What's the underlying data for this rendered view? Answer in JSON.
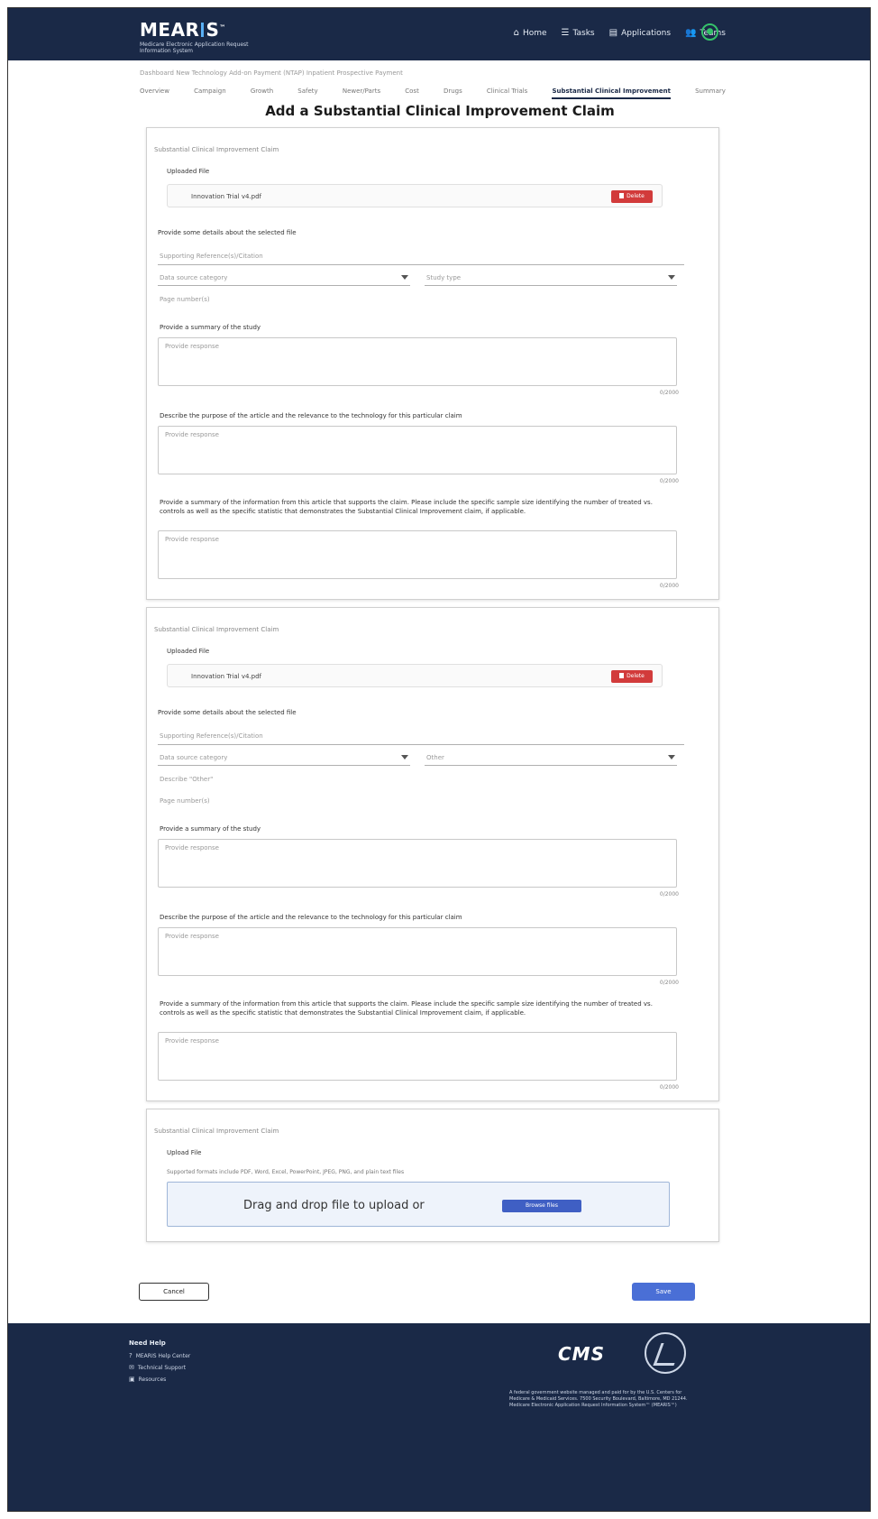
{
  "header": {
    "logo_main": "MEAR",
    "logo_main_end": "S",
    "logo_tm": "™",
    "logo_sub": "Medicare Electronic Application Request Information System",
    "nav": [
      {
        "label": "Home",
        "icon": "home-icon"
      },
      {
        "label": "Tasks",
        "icon": "tasks-icon"
      },
      {
        "label": "Applications",
        "icon": "applications-icon"
      },
      {
        "label": "Teams",
        "icon": "teams-icon"
      }
    ]
  },
  "breadcrumb": "Dashboard  New Technology Add-on Payment (NTAP) Inpatient Prospective Payment",
  "tabs": [
    "Overview",
    "Campaign",
    "Growth",
    "Safety",
    "Newer/Parts",
    "Cost",
    "Drugs",
    "Clinical Trials",
    "Substantial Clinical Improvement",
    "Summary"
  ],
  "active_tab_index": 8,
  "page_title": "Add a Substantial Clinical Improvement Claim",
  "card1": {
    "title": "Substantial Clinical Improvement Claim",
    "uploaded_label": "Uploaded File",
    "file_name": "Innovation Trial v4.pdf",
    "delete_label": "Delete",
    "details_prompt": "Provide some details about the selected file",
    "supporting_placeholder": "Supporting Reference(s)/Citation",
    "data_source_placeholder": "Data source category",
    "study_type_placeholder": "Study type",
    "page_numbers_placeholder": "Page number(s)",
    "q1": "Provide a summary of the study",
    "q1_placeholder": "Provide response",
    "q1_counter": "0/2000",
    "q2": "Describe the purpose of the article and the relevance to the technology for this particular claim",
    "q2_placeholder": "Provide response",
    "q2_counter": "0/2000",
    "q3": "Provide a summary of the information from this article that supports the claim. Please include the specific sample size identifying the number of treated vs. controls as well as the specific statistic that demonstrates the Substantial Clinical Improvement claim, if applicable.",
    "q3_placeholder": "Provide response",
    "q3_counter": "0/2000"
  },
  "card2": {
    "title": "Substantial Clinical Improvement Claim",
    "uploaded_label": "Uploaded File",
    "file_name": "Innovation Trial v4.pdf",
    "delete_label": "Delete",
    "details_prompt": "Provide some details about the selected file",
    "supporting_placeholder": "Supporting Reference(s)/Citation",
    "data_source_placeholder": "Data source category",
    "study_type_value": "Other",
    "describe_other_placeholder": "Describe \"Other\"",
    "page_numbers_placeholder": "Page number(s)",
    "q1": "Provide a summary of the study",
    "q1_placeholder": "Provide response",
    "q1_counter": "0/2000",
    "q2": "Describe the purpose of the article and the relevance to the technology for this particular claim",
    "q2_placeholder": "Provide response",
    "q2_counter": "0/2000",
    "q3": "Provide a summary of the information from this article that supports the claim. Please include the specific sample size identifying the number of treated vs. controls as well as the specific statistic that demonstrates the Substantial Clinical Improvement claim, if applicable.",
    "q3_placeholder": "Provide response",
    "q3_counter": "0/2000"
  },
  "card3": {
    "title": "Substantial Clinical Improvement Claim",
    "upload_label": "Upload File",
    "accepted_types": "Supported formats include PDF, Word, Excel, PowerPoint, JPEG, PNG, and plain text files",
    "drop_text": "Drag and drop file to upload or",
    "browse_label": "Browse files"
  },
  "actions": {
    "cancel": "Cancel",
    "save": "Save"
  },
  "footer": {
    "title": "Need Help",
    "links": [
      {
        "label": "MEARIS Help Center",
        "icon": "help-icon"
      },
      {
        "label": "Technical Support",
        "icon": "support-icon"
      },
      {
        "label": "Resources",
        "icon": "resources-icon"
      }
    ],
    "cms_logo": "CMS",
    "note": "A federal government website managed and paid for by the U.S. Centers for Medicare & Medicaid Services. 7500 Security Boulevard, Baltimore, MD 21244. Medicare Electronic Application Request Information System™ (MEARIS™)"
  }
}
